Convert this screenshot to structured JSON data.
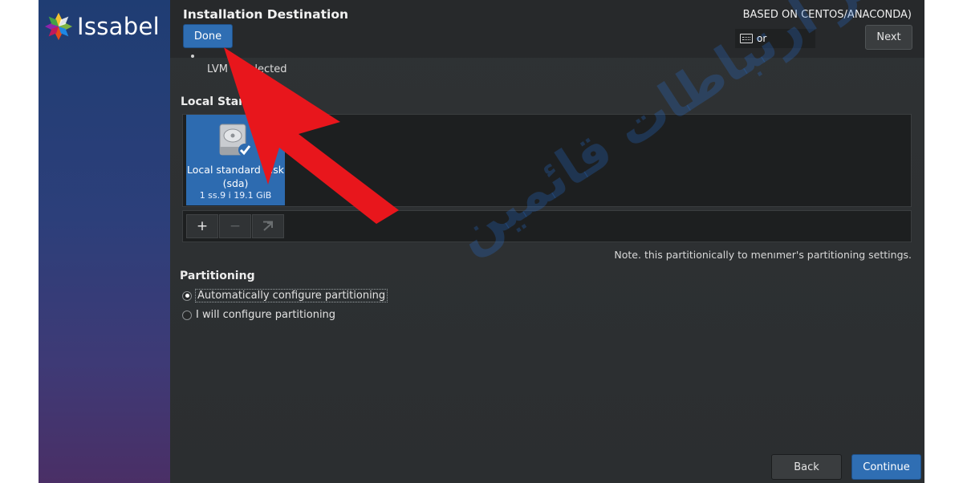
{
  "brand": {
    "name": "Issabel"
  },
  "header": {
    "title": "Installation Destination",
    "done_label": "Done",
    "product": "BASED ON CENTOS/ANACONDA)",
    "keyboard_layout": "or",
    "next_label": "Next"
  },
  "content": {
    "lvm_text": "LVM is selected",
    "local_section": "Local Standar",
    "disk": {
      "name": "Local standard disk",
      "device": "(sda)",
      "size": "1 ss.9 i 19.1 GiB"
    },
    "toolbar": {
      "add": "+",
      "remove": "−",
      "refresh": "⇤"
    },
    "note": "Note. this partitionically to menımer's partitioning settings.",
    "partitioning": {
      "title": "Partitioning",
      "options": [
        {
          "label": "Automatically configure partitioning",
          "selected": true
        },
        {
          "label": "I will configure partitioning",
          "selected": false
        }
      ]
    }
  },
  "footer": {
    "back_label": "Back",
    "continue_label": "Continue"
  },
  "watermark": "عصر ارتباطات قائمين",
  "colors": {
    "accent": "#2f6eb3",
    "arrow": "#e8161c",
    "sidebar": "#2c3f7a",
    "background": "#2e3133"
  }
}
